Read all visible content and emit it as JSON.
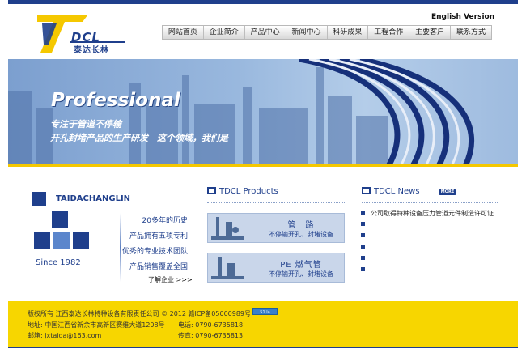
{
  "header": {
    "brand": "DCL",
    "brand_cn": "泰达长林",
    "english_link": "English Version"
  },
  "nav": {
    "items": [
      "网站首页",
      "企业简介",
      "产品中心",
      "新闻中心",
      "科研成果",
      "工程合作",
      "主要客户",
      "联系方式"
    ]
  },
  "banner": {
    "headline": "Professional",
    "line1": "专注于管道不停输",
    "line2": "开孔封堵产品的生产研发　这个领域，我们是"
  },
  "company": {
    "name": "TAIDACHANGLIN",
    "since": "Since 1982",
    "features": [
      "20多年的历史",
      "产品拥有五项专利",
      "优秀的专业技术团队",
      "产品销售覆盖全国"
    ],
    "more": "了解企业 >>>"
  },
  "products": {
    "title": "TDCL Products",
    "items": [
      {
        "name": "管　路",
        "desc": "不停输开孔、封堵设备"
      },
      {
        "name": "PE 燃气管",
        "desc": "不停输开孔、封堵设备"
      }
    ]
  },
  "news": {
    "title": "TDCL News",
    "more": "MORE",
    "items": [
      "公司取得特种设备压力管道元件制造许可证"
    ]
  },
  "footer": {
    "copyright": "版权所有 江西泰达长林特种设备有限责任公司 © 2012 赣ICP备05000989号",
    "badge": "51.la",
    "address": "地址: 中国江西省新余市高新区赛维大道1208号",
    "phone": "电话: 0790-6735818",
    "email": "邮箱: jxtaida@163.com",
    "fax": "传真: 0790-6735813"
  },
  "colors": {
    "brand_blue": "#1f3f8c",
    "accent_yellow": "#f5c800",
    "footer_yellow": "#f7d600"
  }
}
